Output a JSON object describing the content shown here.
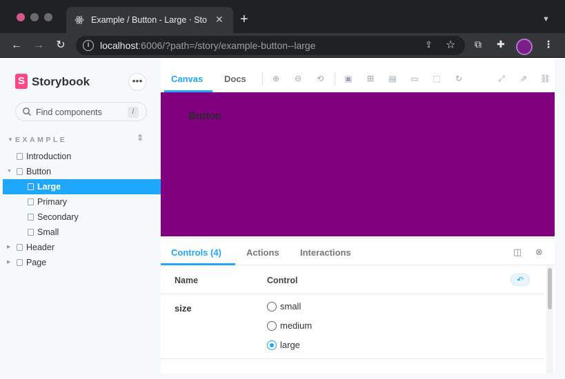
{
  "browser": {
    "tab_title": "Example / Button - Large ⋅ Sto",
    "url_host": "localhost",
    "url_rest": ":6006/?path=/story/example-button--large",
    "new_tab_label": "+"
  },
  "sidebar": {
    "title": "Storybook",
    "menu_label": "•••",
    "search_placeholder": "Find components",
    "search_shortcut": "/",
    "group_label": "EXAMPLE",
    "items": [
      {
        "label": "Introduction"
      },
      {
        "label": "Button"
      },
      {
        "label": "Large"
      },
      {
        "label": "Primary"
      },
      {
        "label": "Secondary"
      },
      {
        "label": "Small"
      },
      {
        "label": "Header"
      },
      {
        "label": "Page"
      }
    ]
  },
  "main": {
    "tabs": [
      {
        "label": "Canvas"
      },
      {
        "label": "Docs"
      }
    ],
    "preview_button_label": "Button",
    "preview_background": "#800080"
  },
  "addons": {
    "tabs": [
      {
        "label": "Controls (4)"
      },
      {
        "label": "Actions"
      },
      {
        "label": "Interactions"
      }
    ],
    "name_header": "Name",
    "control_header": "Control",
    "row": {
      "name": "size",
      "options": [
        {
          "label": "small"
        },
        {
          "label": "medium"
        },
        {
          "label": "large"
        }
      ],
      "selected": "large"
    }
  },
  "colors": {
    "accent": "#1ea7fd",
    "storybook_pink": "#ff4785",
    "chrome_dark": "#202124"
  }
}
